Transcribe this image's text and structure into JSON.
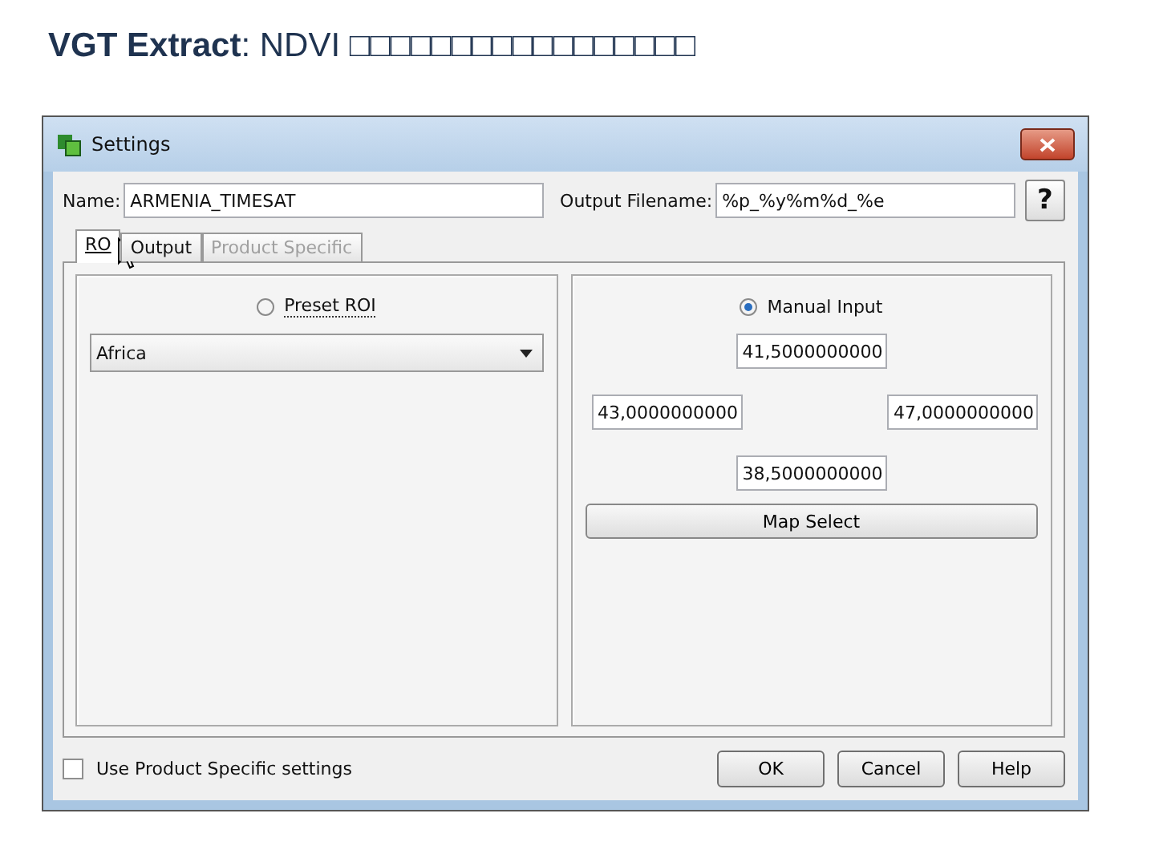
{
  "slide_title": "**VGT Extract**: NDVI □□□□□□□□□□□□□□□□□",
  "window": {
    "title": "Settings"
  },
  "name_field": {
    "label": "Name:",
    "value": "ARMENIA_TIMESAT"
  },
  "output_filename_field": {
    "label": "Output Filename:",
    "value": "%p_%y%m%d_%e"
  },
  "help_icon_button": {
    "label": "?"
  },
  "tabs": [
    {
      "label": "RO",
      "selected": true,
      "disabled": false
    },
    {
      "label": "Output",
      "selected": false,
      "disabled": false
    },
    {
      "label": "Product Specific",
      "selected": false,
      "disabled": true
    }
  ],
  "roi_options": [
    {
      "label": "Preset ROI",
      "selected": false
    },
    {
      "label": "Manual Input",
      "selected": true
    }
  ],
  "preset_dropdown": {
    "value": "Africa"
  },
  "manual_input": {
    "north": "41,5000000000",
    "west": "43,0000000000",
    "east": "47,0000000000",
    "south": "38,5000000000"
  },
  "map_select_button": "Map Select",
  "use_product_specific": {
    "label": "Use Product Specific settings",
    "checked": false
  },
  "buttons": [
    "OK",
    "Cancel",
    "Help"
  ]
}
